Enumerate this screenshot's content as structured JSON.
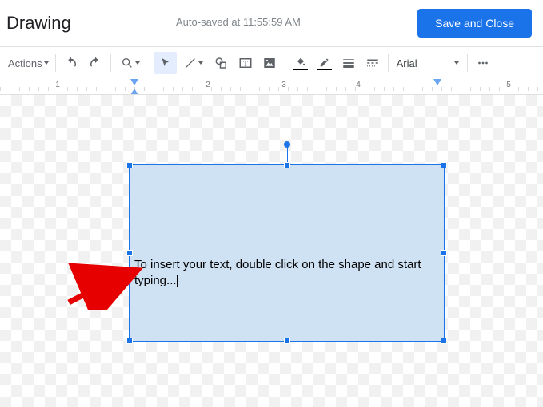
{
  "header": {
    "title": "Drawing",
    "autosave": "Auto-saved at 11:55:59 AM",
    "save_label": "Save and Close"
  },
  "toolbar": {
    "actions_label": "Actions",
    "font": "Arial"
  },
  "ruler": {
    "marks": [
      "1",
      "2",
      "3",
      "4",
      "5"
    ]
  },
  "shape": {
    "text": "To insert your text, double click on the shape and start typing..."
  }
}
